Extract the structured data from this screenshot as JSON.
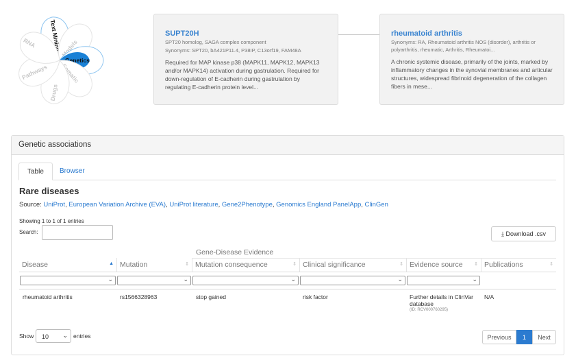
{
  "flower": {
    "petals": [
      "Text Mining",
      "Models",
      "Genetics",
      "Somatic",
      "Drugs",
      "Pathways",
      "RNA"
    ],
    "active": "Genetics",
    "accent": "#1a81d6"
  },
  "target": {
    "name": "SUPT20H",
    "full_name": "SPT20 homolog, SAGA complex component",
    "synonyms": "Synonyms: SPT20, bA421P11.4, P38IP, C13orf19, FAM48A",
    "description": "Required for MAP kinase p38 (MAPK11, MAPK12, MAPK13 and/or MAPK14) activation during gastrulation. Required for down-regulation of E-cadherin during gastrulation by regulating E-cadherin protein level..."
  },
  "disease": {
    "name": "rheumatoid arthritis",
    "synonyms": "Synonyms: RA, Rheumatoid arthritis NOS (disorder), arthritis or polyarthritis, rheumatic, Arthritis, Rheumatoi...",
    "description": "A chronic systemic disease, primarily of the joints, marked by inflammatory changes in the synovial membranes and articular structures, widespread fibrinoid degeneration of the collagen fibers in mese..."
  },
  "panel": {
    "title": "Genetic associations",
    "tabs": [
      "Table",
      "Browser"
    ],
    "active_tab": "Table",
    "section_title": "Rare diseases",
    "source_label": "Source: ",
    "sources": [
      "UniProt",
      "European Variation Archive (EVA)",
      "UniProt literature",
      "Gene2Phenotype",
      "Genomics England PanelApp",
      "ClinGen"
    ],
    "showing": "Showing 1 to 1 of 1 entries",
    "search_label": "Search:",
    "search_value": "",
    "download": "Download .csv",
    "group_header": "Gene-Disease Evidence",
    "columns": [
      "Disease",
      "Mutation",
      "Mutation consequence",
      "Clinical significance",
      "Evidence source",
      "Publications"
    ],
    "rows": [
      {
        "disease": "rheumatoid arthritis",
        "mutation": "rs1566328963",
        "consequence": "stop gained",
        "significance": "risk factor",
        "evidence": "Further details in ClinVar database",
        "evidence_id": "(ID: RCV000760295)",
        "publications": "N/A"
      }
    ],
    "show_label": "Show",
    "page_size": "10",
    "entries_label": "entries",
    "prev": "Previous",
    "page": "1",
    "next": "Next"
  }
}
